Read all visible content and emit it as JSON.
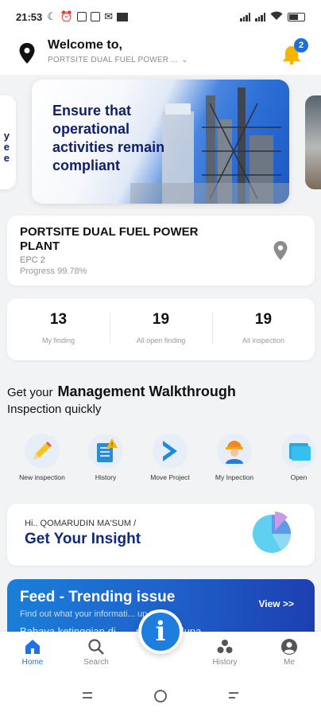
{
  "status_bar": {
    "time": "21:53"
  },
  "header": {
    "welcome": "Welcome to,",
    "project_selector": "PORTSITE DUAL FUEL POWER ...",
    "notification_count": "2"
  },
  "carousel": {
    "left_card_text": "y\ne\ne",
    "hero_text": "Ensure that operational activities remain compliant"
  },
  "project": {
    "name": "PORTSITE DUAL FUEL POWER PLANT",
    "epc": "EPC 2",
    "progress": "Progress 99.78%"
  },
  "stats": [
    {
      "value": "13",
      "label": "My finding"
    },
    {
      "value": "19",
      "label": "All open finding"
    },
    {
      "value": "19",
      "label": "All inspection"
    }
  ],
  "walkthrough": {
    "prefix": "Get your",
    "title": "Management Walkthrough",
    "subtitle": "Inspection quickly"
  },
  "menu": [
    {
      "label": "New inspection",
      "icon": "pencil-icon"
    },
    {
      "label": "History",
      "icon": "notebook-warning-icon"
    },
    {
      "label": "Move Project",
      "icon": "chevron-right-icon"
    },
    {
      "label": "My Inpection",
      "icon": "worker-icon"
    },
    {
      "label": "Open",
      "icon": "folder-icon"
    }
  ],
  "insight": {
    "greeting": "Hi.. QOMARUDIN MA'SUM /",
    "title": "Get Your Insight"
  },
  "feed": {
    "title": "Feed - Trending issue",
    "subtitle": "Find out what your informati... up to!",
    "view": "View >>",
    "preview": "Bahaya ketinggian di... ...ra jangan lupa"
  },
  "fab": {
    "label": "i"
  },
  "bottom_nav": [
    {
      "label": "Home",
      "active": true
    },
    {
      "label": "Search"
    },
    {
      "label": "History"
    },
    {
      "label": "Me"
    }
  ],
  "colors": {
    "accent": "#1e73e8",
    "navy": "#0f1f6b",
    "bell": "#f5b400"
  }
}
